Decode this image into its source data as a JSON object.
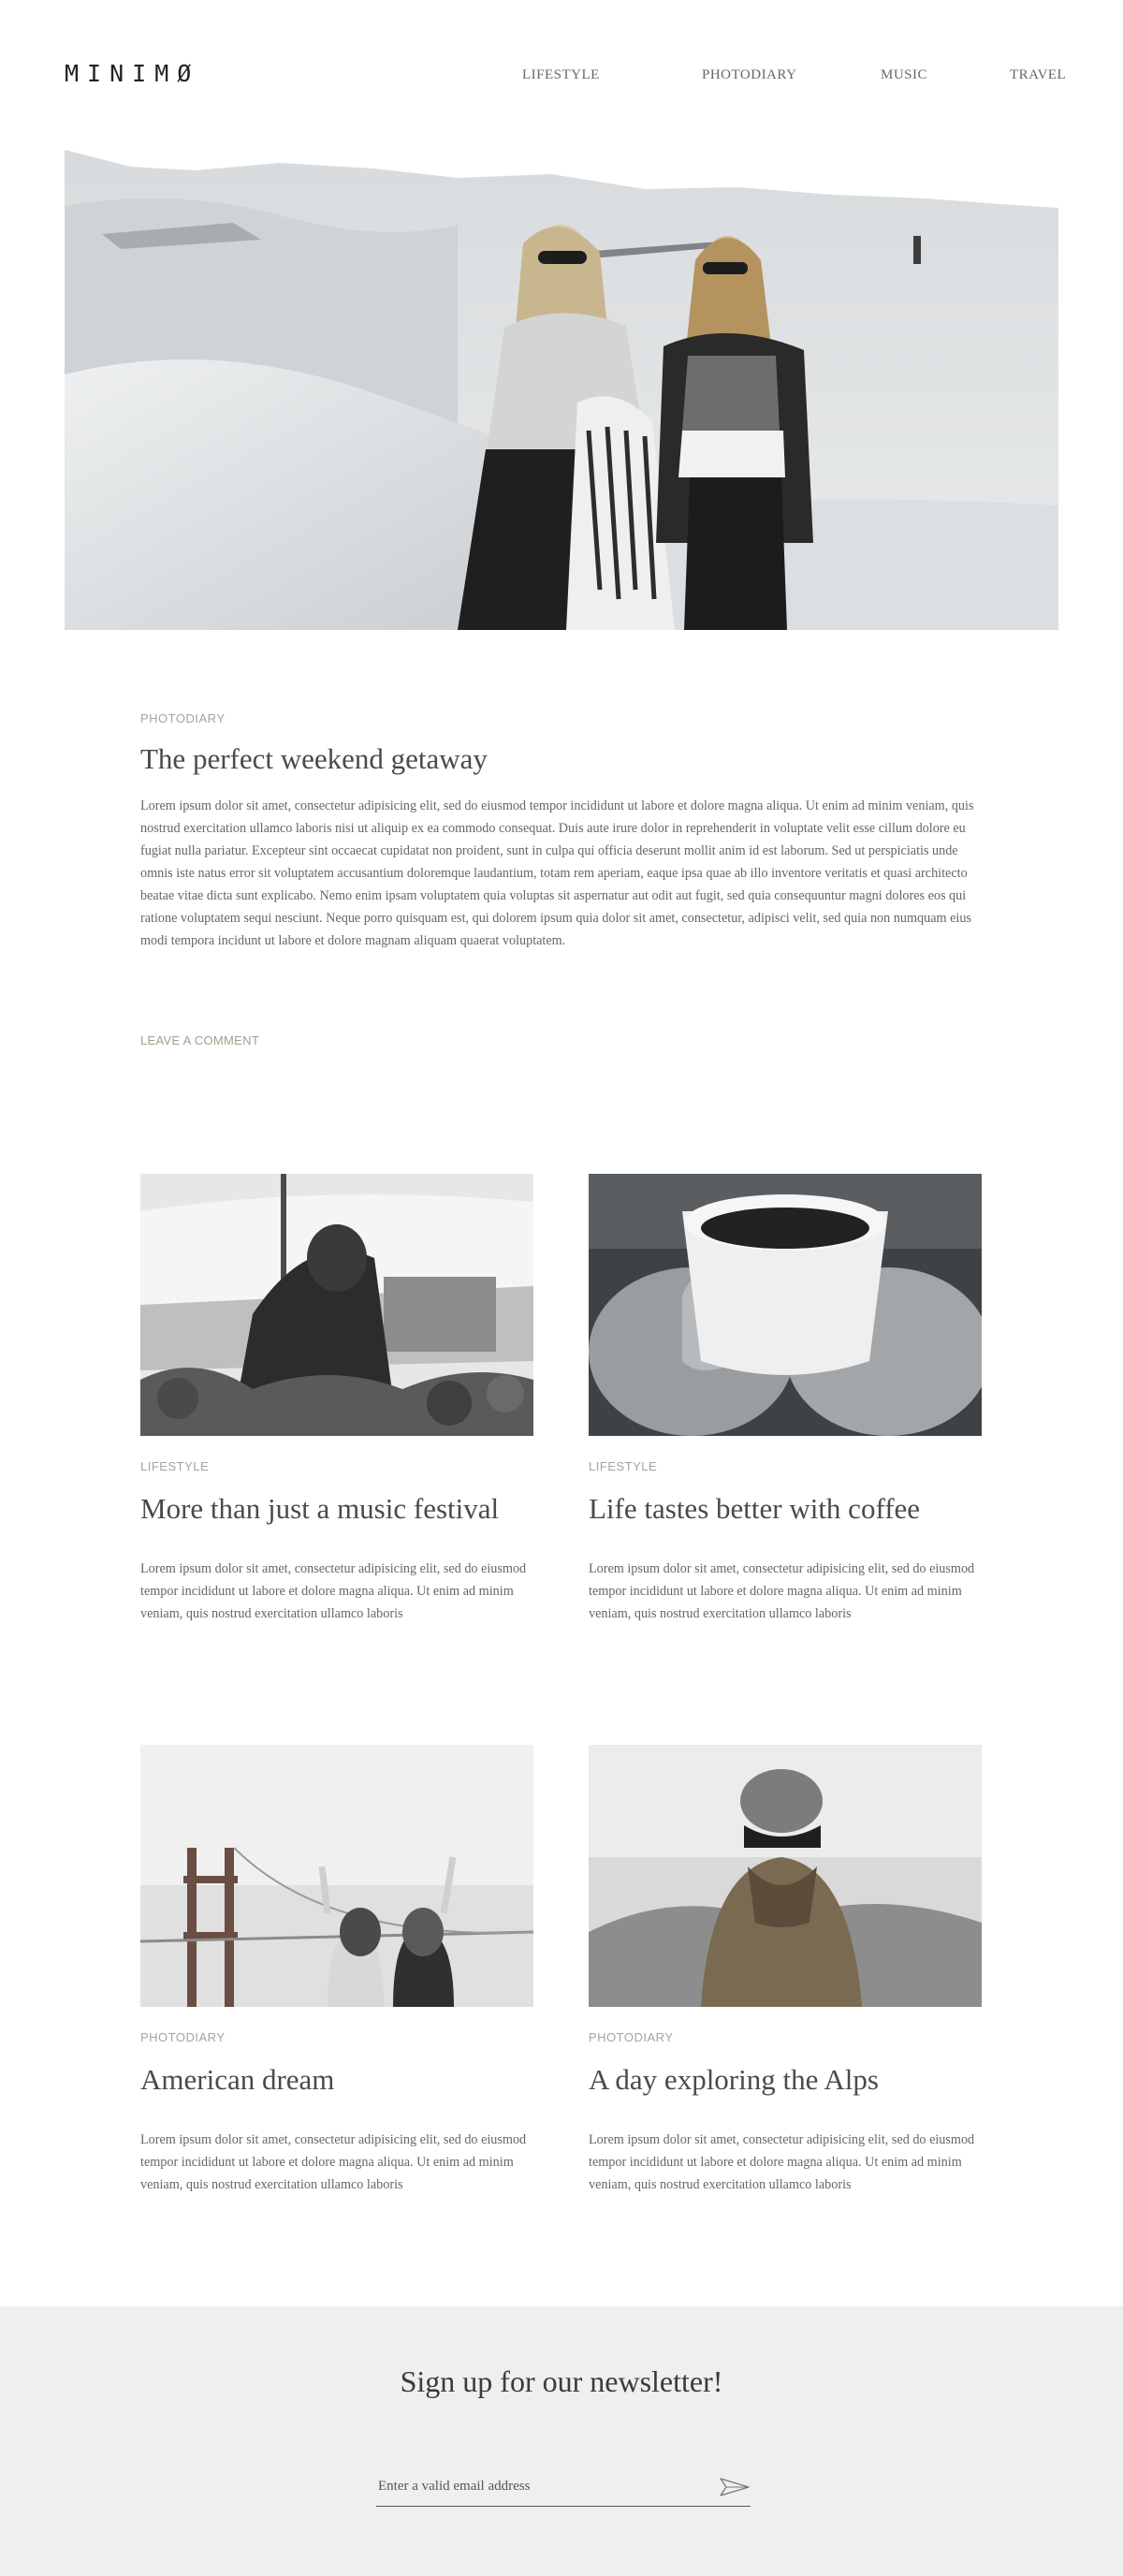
{
  "header": {
    "logo": "MINIMØ",
    "nav": [
      "LIFESTYLE",
      "PHOTODIARY",
      "MUSIC",
      "TRAVEL"
    ]
  },
  "featured": {
    "category": "PHOTODIARY",
    "title": "The perfect weekend getaway",
    "body": "Lorem ipsum dolor sit amet, consectetur adipisicing elit, sed do eiusmod tempor incididunt ut labore et dolore magna aliqua. Ut enim ad minim veniam, quis nostrud exercitation ullamco laboris nisi ut aliquip ex ea commodo consequat. Duis aute irure dolor in reprehenderit in voluptate velit esse cillum dolore eu fugiat nulla pariatur. Excepteur sint occaecat cupidatat non proident, sunt in culpa qui officia deserunt mollit anim id est laborum. Sed ut perspiciatis unde omnis iste natus error sit voluptatem accusantium doloremque laudantium, totam rem aperiam, eaque ipsa quae ab illo inventore veritatis et quasi architecto beatae vitae dicta sunt explicabo. Nemo enim ipsam voluptatem quia voluptas sit aspernatur aut odit aut fugit, sed quia consequuntur magni dolores eos qui ratione voluptatem sequi nesciunt. Neque porro quisquam est, qui dolorem ipsum quia dolor sit amet, consectetur, adipisci velit, sed quia non numquam eius modi tempora incidunt ut labore et dolore magnam aliquam quaerat voluptatem.",
    "leave_comment": "LEAVE A COMMENT"
  },
  "posts": [
    {
      "category": "LIFESTYLE",
      "title": "More than just a music festival",
      "excerpt": "Lorem ipsum dolor sit amet, consectetur adipisicing elit, sed do eiusmod tempor incididunt ut labore et dolore magna aliqua. Ut enim ad minim veniam, quis nostrud exercitation ullamco laboris"
    },
    {
      "category": "LIFESTYLE",
      "title": "Life tastes better with coffee",
      "excerpt": "Lorem ipsum dolor sit amet, consectetur adipisicing elit, sed do eiusmod tempor incididunt ut labore et dolore magna aliqua. Ut enim ad minim veniam, quis nostrud exercitation ullamco laboris"
    },
    {
      "category": "PHOTODIARY",
      "title": "American dream",
      "excerpt": "Lorem ipsum dolor sit amet, consectetur adipisicing elit, sed do eiusmod tempor incididunt ut labore et dolore magna aliqua. Ut enim ad minim veniam, quis nostrud exercitation ullamco laboris"
    },
    {
      "category": "PHOTODIARY",
      "title": "A day exploring the Alps",
      "excerpt": "Lorem ipsum dolor sit amet, consectetur adipisicing elit, sed do eiusmod tempor incididunt ut labore et dolore magna aliqua. Ut enim ad minim veniam, quis nostrud exercitation ullamco laboris"
    }
  ],
  "newsletter": {
    "title": "Sign up for our newsletter!",
    "email_placeholder": "Enter a valid email address",
    "send_icon": "paper-plane-icon"
  }
}
